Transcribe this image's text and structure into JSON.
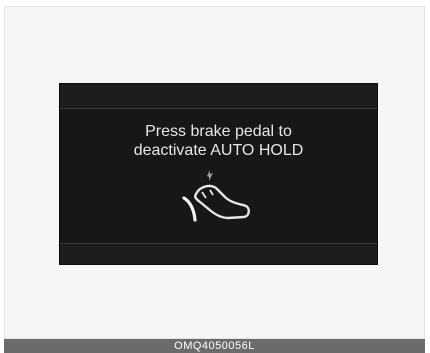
{
  "display": {
    "message_line1": "Press brake pedal to",
    "message_line2": "deactivate AUTO HOLD",
    "icon": "brake-pedal-press-icon"
  },
  "caption": {
    "code": "OMQ4050056L"
  },
  "colors": {
    "display_background": "#171717",
    "display_text": "#e6e6e6",
    "caption_background": "#6b6b6b"
  }
}
